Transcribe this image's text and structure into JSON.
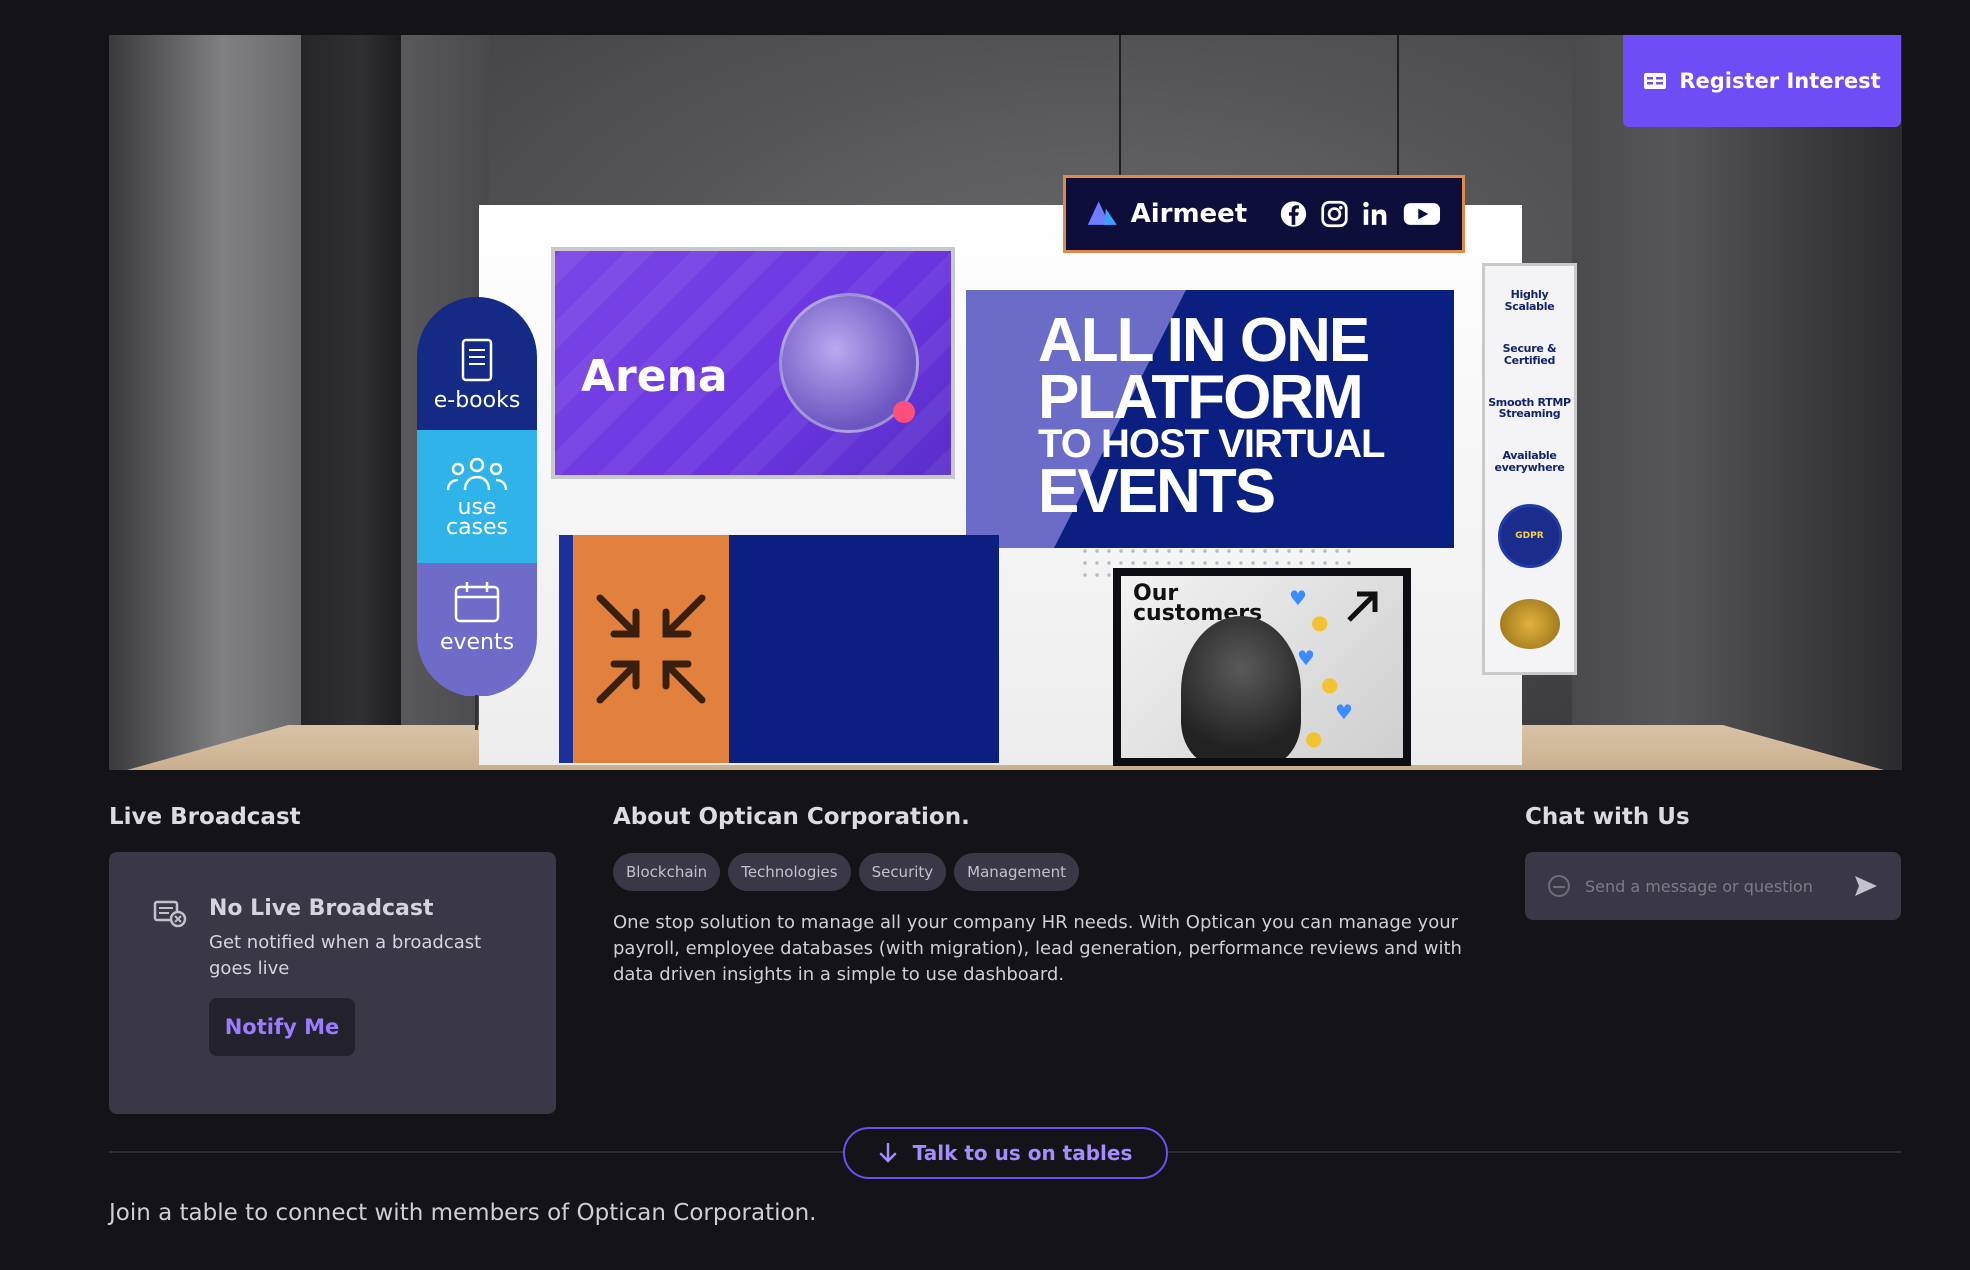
{
  "header": {
    "register_label": "Register Interest"
  },
  "booth": {
    "sign_brand": "Airmeet",
    "banner_items": [
      {
        "label": "e-books"
      },
      {
        "label": "use cases"
      },
      {
        "label": "events"
      }
    ],
    "arena_title": "Arena",
    "platform_lines": [
      "ALL IN ONE",
      "PLATFORM",
      "TO HOST VIRTUAL",
      "EVENTS"
    ],
    "customers_title": "Our customers",
    "features": [
      "Highly Scalable",
      "Secure & Certified",
      "Smooth RTMP Streaming",
      "Available everywhere"
    ],
    "gdpr_label": "GDPR"
  },
  "live_broadcast": {
    "title": "Live Broadcast",
    "card_title": "No Live Broadcast",
    "card_sub": "Get notified when a broadcast goes live",
    "notify_label": "Notify Me"
  },
  "about": {
    "title": "About Optican Corporation.",
    "tags": [
      "Blockchain",
      "Technologies",
      "Security",
      "Management"
    ],
    "description": "One stop solution to manage all your company HR needs. With Optican you can manage your payroll, employee databases (with migration), lead generation, performance reviews and with data driven insights in a simple to use dashboard."
  },
  "chat": {
    "title": "Chat with Us",
    "placeholder": "Send a message or question"
  },
  "tables": {
    "button_label": "Talk to us on tables",
    "join_text": "Join a table to connect with members of Optican Corporation."
  },
  "colors": {
    "accent": "#6e4cf6",
    "background": "#141317",
    "card": "#3a3847"
  }
}
